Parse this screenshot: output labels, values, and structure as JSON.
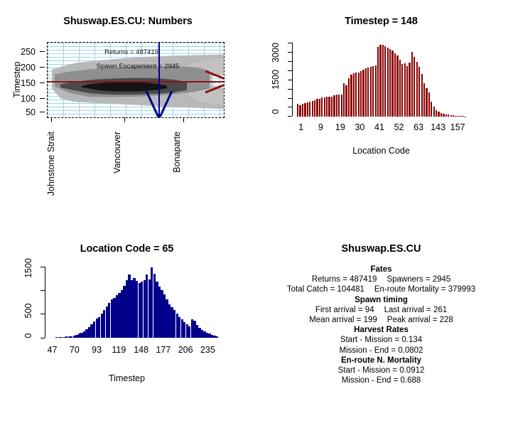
{
  "colors": {
    "bar_red": "#8B0000",
    "bar_navy": "#00008B",
    "grid_blue": "#9fd4e8",
    "marker_red": "#8B1414",
    "marker_blue": "#00008B",
    "cloud_grey": "#b3b3b3"
  },
  "panels": {
    "heatmap": {
      "title": "Shuswap.ES.CU: Numbers",
      "ylabel": "Timestep",
      "y_ticks": [
        "250",
        "200",
        "150",
        "100",
        "50"
      ],
      "x_ticks": [
        "Johnstone Strait",
        "Vancouver",
        "Bonaparte"
      ],
      "annotations": {
        "returns": "Returns = 487419",
        "escapement": "Spawn Escapement = 2945"
      },
      "marker_timestep": 148,
      "marker_location_code": 65
    },
    "timestep_bars": {
      "title": "Timestep = 148",
      "xlabel": "Location Code",
      "y_ticks": [
        "3000",
        "1500",
        "0"
      ]
    },
    "location_bars": {
      "title": "Location Code = 65",
      "xlabel": "Timestep",
      "y_ticks": [
        "1500",
        "500",
        "0"
      ]
    },
    "summary": {
      "title": "Shuswap.ES.CU",
      "sections": [
        {
          "heading": "Fates",
          "rows": [
            [
              "Returns = 487419",
              "Spawners = 2945"
            ],
            [
              "Total Catch = 104481",
              "En-route Mortality = 379993"
            ]
          ]
        },
        {
          "heading": "Spawn timing",
          "rows": [
            [
              "First arrival = 94",
              "Last arrival = 261"
            ],
            [
              "Mean arrival = 199",
              "Peak arrival = 228"
            ]
          ]
        },
        {
          "heading": "Harvest Rates",
          "rows": [
            [
              "Start - Mission = 0.134"
            ],
            [
              "Mission - End = 0.0802"
            ]
          ]
        },
        {
          "heading": "En-route N. Mortality",
          "rows": [
            [
              "Start - Mission = 0.0912"
            ],
            [
              "Mission - End = 0.688"
            ]
          ]
        }
      ]
    }
  },
  "chart_data": [
    {
      "type": "heatmap",
      "title": "Shuswap.ES.CU: Numbers",
      "xlabel": "",
      "ylabel": "Timestep",
      "x_tick_labels": [
        "Johnstone Strait",
        "Vancouver",
        "Bonaparte"
      ],
      "x_tick_positions": [
        1,
        65,
        128
      ],
      "y_tick_labels": [
        "50",
        "100",
        "150",
        "200",
        "250"
      ],
      "ylim": [
        30,
        275
      ],
      "grid": true,
      "annotations": [
        "Returns = 487419",
        "Spawn Escapement = 2945"
      ],
      "crosshair": {
        "timestep": 148,
        "location_code": 65
      },
      "description": "Greyscale density of migrating fish numbers over location (x) and timestep (y); dark core band runs from timestep ~120 at Johnstone Strait rising to ~150 near Bonaparte."
    },
    {
      "type": "bar",
      "title": "Timestep = 148",
      "xlabel": "Location Code",
      "ylabel": "",
      "ylim": [
        0,
        3750
      ],
      "grid": false,
      "x_tick_labels": [
        "1",
        "9",
        "19",
        "30",
        "41",
        "52",
        "63",
        "143",
        "157"
      ],
      "x_tick_indices": [
        0,
        5,
        12,
        19,
        26,
        33,
        40,
        51,
        59
      ],
      "categories": [
        "1",
        "2",
        "3",
        "4",
        "5",
        "6",
        "7",
        "8",
        "9",
        "10",
        "11",
        "12",
        "13",
        "14",
        "15",
        "16",
        "17",
        "18",
        "19",
        "20",
        "21",
        "22",
        "23",
        "24",
        "25",
        "26",
        "27",
        "28",
        "29",
        "30",
        "31",
        "32",
        "33",
        "34",
        "35",
        "36",
        "37",
        "38",
        "39",
        "40",
        "41",
        "42",
        "43",
        "44",
        "45",
        "46",
        "47",
        "48",
        "49",
        "50",
        "51",
        "52",
        "53",
        "54",
        "55",
        "56",
        "57",
        "58",
        "59",
        "60",
        "61",
        "62",
        "63",
        "64",
        "65",
        "66",
        "67",
        "68",
        "69",
        "70"
      ],
      "values": [
        620,
        560,
        620,
        680,
        700,
        740,
        780,
        820,
        880,
        900,
        940,
        960,
        980,
        980,
        1000,
        1060,
        1080,
        1090,
        1100,
        1660,
        1540,
        1900,
        2080,
        2160,
        2180,
        2200,
        2260,
        2320,
        2400,
        2440,
        2480,
        2520,
        2560,
        3460,
        3560,
        3580,
        3500,
        3440,
        3360,
        3300,
        3160,
        3060,
        2820,
        2620,
        2660,
        2520,
        2680,
        3220,
        2960,
        2720,
        2480,
        2120,
        1680,
        1400,
        1220,
        740,
        480,
        320,
        240,
        180,
        140,
        110,
        90,
        70,
        55,
        45,
        36,
        30,
        24,
        18
      ]
    },
    {
      "type": "bar",
      "title": "Location Code = 65",
      "xlabel": "Timestep",
      "ylabel": "",
      "ylim": [
        0,
        1680
      ],
      "grid": false,
      "x_tick_labels": [
        "47",
        "70",
        "93",
        "119",
        "148",
        "177",
        "206",
        "235"
      ],
      "categories": [
        "47",
        "50",
        "53",
        "56",
        "59",
        "62",
        "65",
        "68",
        "71",
        "74",
        "77",
        "80",
        "83",
        "86",
        "89",
        "92",
        "95",
        "98",
        "101",
        "104",
        "107",
        "110",
        "113",
        "116",
        "119",
        "122",
        "125",
        "128",
        "131",
        "134",
        "137",
        "140",
        "143",
        "146",
        "149",
        "152",
        "155",
        "158",
        "161",
        "164",
        "167",
        "170",
        "173",
        "176",
        "179",
        "182",
        "185",
        "188",
        "191",
        "194",
        "197",
        "200",
        "203",
        "206",
        "209",
        "212",
        "215",
        "218",
        "221",
        "224",
        "227",
        "230",
        "233",
        "236",
        "239"
      ],
      "values": [
        10,
        14,
        18,
        22,
        26,
        32,
        40,
        55,
        70,
        90,
        120,
        150,
        190,
        240,
        300,
        370,
        430,
        470,
        540,
        620,
        700,
        790,
        860,
        900,
        960,
        1010,
        1080,
        1170,
        1300,
        1420,
        1300,
        1340,
        1280,
        1230,
        1260,
        1300,
        1430,
        1320,
        1580,
        1440,
        1260,
        1160,
        1080,
        980,
        870,
        760,
        690,
        620,
        540,
        470,
        420,
        360,
        300,
        260,
        410,
        380,
        290,
        230,
        180,
        150,
        120,
        90,
        70,
        50,
        35
      ]
    }
  ]
}
